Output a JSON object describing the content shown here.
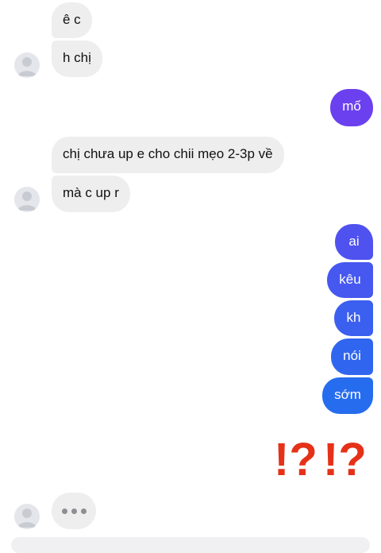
{
  "messages": {
    "incoming_1": [
      "ê c",
      "h chị"
    ],
    "outgoing_1": "mố",
    "incoming_2": [
      "chị chưa up e cho chii mẹo 2-3p về",
      "mà c up r"
    ],
    "outgoing_2": [
      "ai",
      "kêu",
      "kh",
      "nói",
      "sớm"
    ]
  },
  "reaction": {
    "icon": "double-exclamation-question-icon",
    "color": "#e53118"
  },
  "typing_indicator": {
    "icon": "typing-dots-icon"
  },
  "colors": {
    "incoming_bubble": "#eeeeef",
    "outgoing_gradient_top": "#7a3ff2",
    "outgoing_gradient_bottom": "#1f6ff0"
  }
}
